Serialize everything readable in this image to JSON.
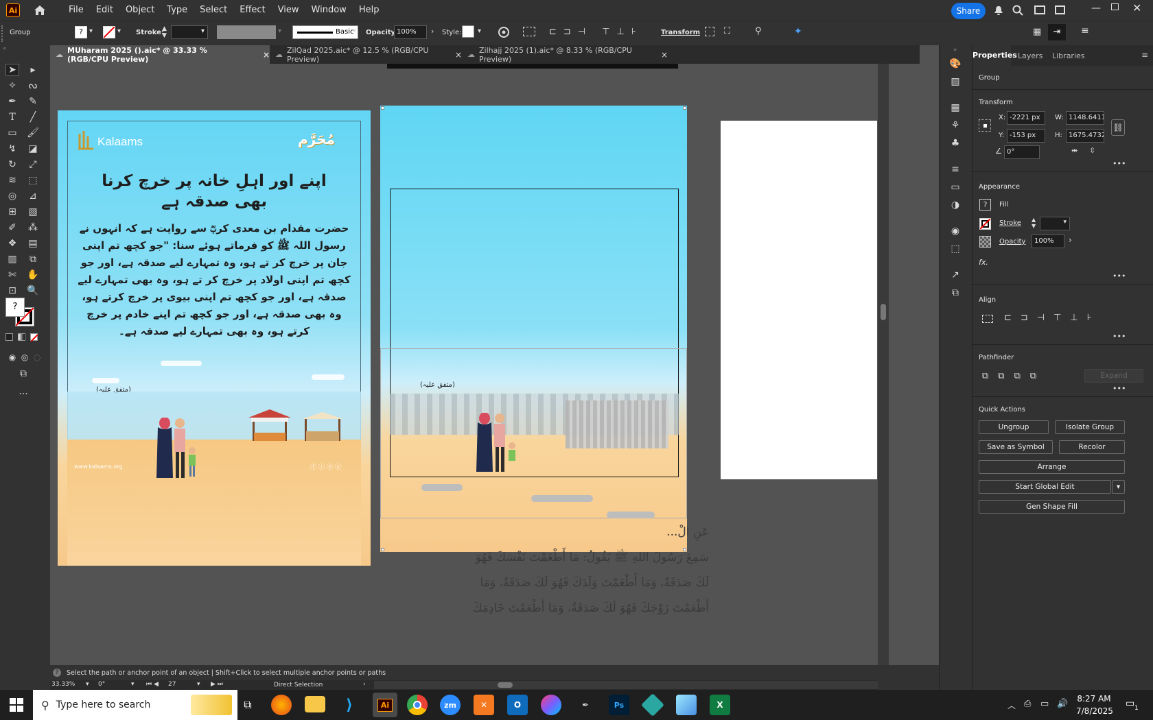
{
  "app": {
    "logo": "Ai"
  },
  "menu": [
    "File",
    "Edit",
    "Object",
    "Type",
    "Select",
    "Effect",
    "View",
    "Window",
    "Help"
  ],
  "share_label": "Share",
  "control": {
    "selection": "Group",
    "stroke_label": "Stroke:",
    "brush_label": "Basic",
    "opacity_label": "Opacity:",
    "opacity_value": "100%",
    "style_label": "Style:",
    "transform_label": "Transform"
  },
  "tabs": [
    {
      "label": "MUharam 2025 ().aic* @ 33.33 % (RGB/CPU Preview)",
      "close": "×"
    },
    {
      "label": "ZilQad 2025.aic* @ 12.5 % (RGB/CPU Preview)",
      "close": "×"
    },
    {
      "label": "Zilhajj 2025 (1).aic* @ 8.33 % (RGB/CPU Preview)",
      "close": "×"
    }
  ],
  "artboard1": {
    "brand": "Kalaams",
    "badge": "مُحَرَّم",
    "heading": "اپنے اور اہلِ خانہ پر خرچ کرنا بھی صدقہ ہے",
    "body": "حضرت مقدام بن معدی کربؓ سے روایت ہے کہ انہوں نے رسول اللہ ﷺ کو فرماتے ہوئے سنا: \"جو کچھ تم اپنی جان پر خرچ کر تے ہو، وہ تمہارے لیے صدقہ ہے، اور جو کچھ تم اپنی اولاد پر خرچ کر تے ہو، وہ بھی تمہارے لیے صدقہ ہے، اور جو کچھ تم اپنی بیوی پر خرچ کرتے ہو، وہ بھی صدقہ ہے، اور جو کچھ تم اپنے خادم پر خرچ کرتے ہو، وہ بھی تمہارے لیے صدقہ ہے۔",
    "reference": "(متفق علیہ)",
    "website": "www.kalaams.org"
  },
  "artboard2": {
    "reference": "(متفق علیہ)"
  },
  "arabic_lines": [
    "عَنِ الْ...",
    "سَمِعَ رَسُولَ اللهِ ﷺ يَقُولُ: مَا أَطْعَمْتَ نَفْسَكَ فَهُوَ",
    "لَكَ صَدَقَةٌ، وَمَا أَطْعَمْتَ وَلَدَكَ فَهُوَ لَكَ صَدَقَةٌ، وَمَا",
    "أَطْعَمْتَ زَوْجَكَ فَهُوَ لَكَ صَدَقَةٌ، وَمَا أَطْعَمْتَ خَادِمَكَ"
  ],
  "panel": {
    "tabs": [
      "Properties",
      "Layers",
      "Libraries"
    ],
    "selection": "Group",
    "transform_title": "Transform",
    "x_label": "X:",
    "x_value": "-2221 px",
    "y_label": "Y:",
    "y_value": "-153 px",
    "w_label": "W:",
    "w_value": "1148.6411",
    "h_label": "H:",
    "h_value": "1675.4732",
    "angle_value": "0°",
    "appearance_title": "Appearance",
    "fill_label": "Fill",
    "stroke_label": "Stroke",
    "opacity_label": "Opacity",
    "opacity_value": "100%",
    "fx_label": "fx.",
    "align_title": "Align",
    "pathfinder_title": "Pathfinder",
    "expand_label": "Expand",
    "quick_actions_title": "Quick Actions",
    "buttons": [
      "Ungroup",
      "Isolate Group",
      "Save as Symbol",
      "Recolor",
      "Arrange",
      "Start Global Edit",
      "Gen Shape Fill"
    ]
  },
  "status": {
    "hint": "Select the path or anchor point of an object  |  Shift+Click to select multiple anchor points or paths",
    "zoom": "33.33%",
    "rotation": "0°",
    "artboard_num": "27",
    "tool_name": "Direct Selection"
  },
  "taskbar": {
    "search_placeholder": "Type here to search",
    "time": "8:27 AM",
    "date": "7/8/2025",
    "notif_count": "1"
  },
  "colors": {
    "accent": "#1473e6",
    "sky": "#5fd6f4",
    "sand": "#f7c98b",
    "ai_orange": "#ff9a00"
  }
}
